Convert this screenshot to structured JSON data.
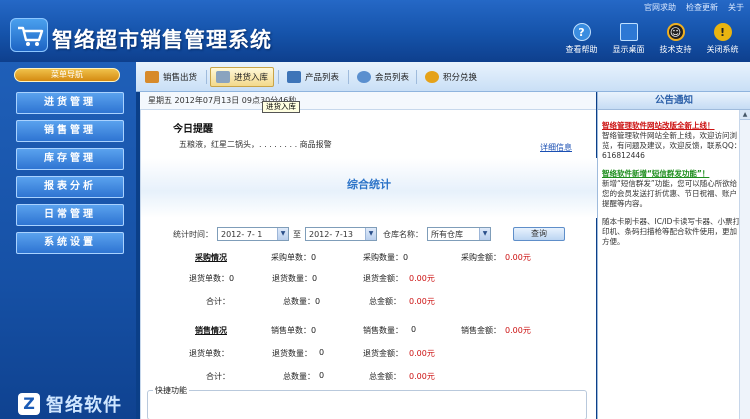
{
  "app": {
    "title": "智络超市销售管理系统",
    "top_links": [
      "官网求助",
      "检查更新",
      "关于"
    ],
    "toolbar": [
      {
        "label": "查看帮助",
        "icon": "help-icon",
        "color": "#3a8de0"
      },
      {
        "label": "显示桌面",
        "icon": "desktop-icon",
        "color": "#2d78d4"
      },
      {
        "label": "技术支持",
        "icon": "qq-icon",
        "color": "#e29b12"
      },
      {
        "label": "关闭系统",
        "icon": "warning-icon",
        "color": "#e9b410"
      }
    ]
  },
  "sidebar": {
    "header": "菜单导航",
    "items": [
      "进货管理",
      "销售管理",
      "库存管理",
      "报表分析",
      "日常管理",
      "系统设置"
    ],
    "footer_logo": "智络软件"
  },
  "tabs": [
    {
      "label": "销售出货",
      "icon": "shopping-bag-icon",
      "active": false
    },
    {
      "label": "进货入库",
      "icon": "cart-icon",
      "active": true
    },
    {
      "label": "产品列表",
      "icon": "product-list-icon",
      "active": false
    },
    {
      "label": "会员列表",
      "icon": "members-icon",
      "active": false
    },
    {
      "label": "积分兑换",
      "icon": "exchange-icon",
      "active": false
    }
  ],
  "date_bar": {
    "text": "星期五  2012年07月13日  09点30分46秒"
  },
  "tooltip": "进货入库",
  "reminder": {
    "title": "今日提醒",
    "text": "五粮液，红星二锅头，. . . . . . . . 商品报警",
    "more_link": "详细信息"
  },
  "stats": {
    "title": "综合统计",
    "filter": {
      "time_label": "统计时间：",
      "date_from": "2012- 7- 1",
      "to_label": "至",
      "date_to": "2012- 7-13",
      "warehouse_label": "仓库名称：",
      "warehouse_value": "所有仓库",
      "query_button": "查询"
    },
    "purchase": {
      "title": "采购情况",
      "rows": [
        [
          "采购单数：0",
          "采购数量：0",
          "采购金额：",
          "0.00元"
        ],
        [
          "退货单数：0",
          "退货数量：0",
          "退货金额：",
          "0.00元"
        ],
        [
          "合计：",
          "总数量：0",
          "总金额：",
          "0.00元"
        ]
      ]
    },
    "sales": {
      "title": "销售情况",
      "rows": [
        [
          "销售单数：0",
          "销售数量：",
          "0",
          "销售金额：",
          "0.00元"
        ],
        [
          "退货单数：",
          "退货数量：",
          "0",
          "退货金额：",
          "0.00元"
        ],
        [
          "合计：",
          "总数量：",
          "0",
          "总金额：",
          "0.00元"
        ]
      ]
    },
    "quick_title": "快捷功能"
  },
  "announcement": {
    "title": "公告通知",
    "items": [
      {
        "heading": "智络管理软件网站改版全新上线！",
        "text": "智络管理软件网站全新上线，欢迎访问浏览，有问题及建议，欢迎反馈，联系QQ：616812446"
      },
      {
        "heading": "智络软件新增“短信群发功能”！",
        "text": "新增“短信群发”功能，您可以随心所欲给您的会员发送打折优惠、节日祝福、账户提醒等内容。"
      },
      {
        "heading": "",
        "text": "随本卡刷卡器、IC/ID卡读写卡器、小票打印机、条码扫描枪等配合软件使用，更加方便。"
      }
    ]
  }
}
